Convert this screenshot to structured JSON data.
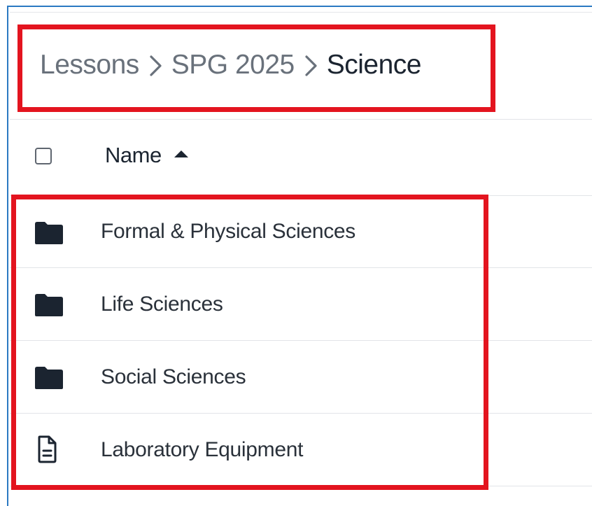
{
  "breadcrumb": {
    "items": [
      {
        "label": "Lessons"
      },
      {
        "label": "SPG 2025"
      },
      {
        "label": "Science"
      }
    ]
  },
  "table": {
    "columns": [
      {
        "label": "Name",
        "sort": "ascending"
      }
    ],
    "rows": [
      {
        "type": "folder",
        "icon": "folder-icon",
        "label": "Formal & Physical Sciences"
      },
      {
        "type": "folder",
        "icon": "folder-icon",
        "label": "Life Sciences"
      },
      {
        "type": "folder",
        "icon": "folder-icon",
        "label": "Social Sciences"
      },
      {
        "type": "document",
        "icon": "document-icon",
        "label": "Laboratory Equipment"
      }
    ]
  },
  "colors": {
    "highlight": "#e3141f",
    "window_border": "#2b79c2",
    "icon": "#1b2430"
  }
}
